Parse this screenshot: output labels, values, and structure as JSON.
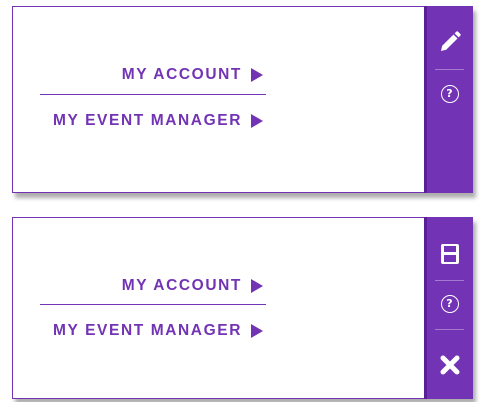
{
  "panels": [
    {
      "links": {
        "my_account": "MY ACCOUNT",
        "my_event_manager": "MY EVENT MANAGER"
      },
      "sidebar_icons": [
        "pencil-icon",
        "help-icon"
      ],
      "help_glyph": "?"
    },
    {
      "links": {
        "my_account": "MY ACCOUNT",
        "my_event_manager": "MY EVENT MANAGER"
      },
      "sidebar_icons": [
        "save-icon",
        "help-icon",
        "close-icon"
      ],
      "help_glyph": "?"
    }
  ],
  "colors": {
    "accent": "#7233b4",
    "accent_dark": "#5a1e98",
    "icon": "#ffffff",
    "background": "#ffffff"
  }
}
